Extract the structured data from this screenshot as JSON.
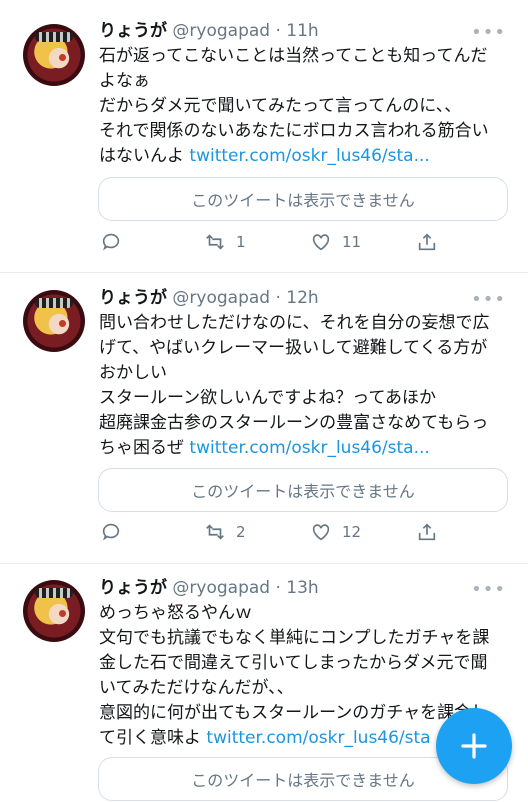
{
  "tweets": [
    {
      "name": "りょうが",
      "handle": "@ryogapad",
      "time": "· 11h",
      "lines": [
        "石が返ってこないことは当然ってことも知ってんだ",
        "よなぁ",
        "だからダメ元で聞いてみたって言ってんのに、、",
        "それで関係のないあなたにボロカス言われる筋合い"
      ],
      "last_text": "はないんよ ",
      "link": "twitter.com/oskr_lus46/sta...",
      "card": "このツイートは表示できません",
      "reply_count": "",
      "retweet_count": "1",
      "like_count": "11"
    },
    {
      "name": "りょうが",
      "handle": "@ryogapad",
      "time": "· 12h",
      "lines": [
        "問い合わせしただけなのに、それを自分の妄想で広",
        "げて、やばいクレーマー扱いして避難してくる方が",
        "おかしい",
        "スタールーン欲しいんですよね？ってあほか",
        "超廃課金古参のスタールーンの豊富さなめてもらっ"
      ],
      "last_text": "ちゃ困るぜ ",
      "link": "twitter.com/oskr_lus46/sta...",
      "card": "このツイートは表示できません",
      "reply_count": "",
      "retweet_count": "2",
      "like_count": "12"
    },
    {
      "name": "りょうが",
      "handle": "@ryogapad",
      "time": "· 13h",
      "lines": [
        "めっちゃ怒るやんｗ",
        "文句でも抗議でもなく単純にコンプしたガチャを課",
        "金した石で間違えて引いてしまったからダメ元で聞",
        "いてみただけなんだが、、",
        "意図的に何が出てもスタールーンのガチャを課金し"
      ],
      "last_text": "て引く意味よ ",
      "link": "twitter.com/oskr_lus46/sta",
      "card": "このツイートは表示できません"
    }
  ],
  "colors": {
    "accent": "#1da1f2",
    "link": "#1b95e0",
    "secondary": "#657786"
  },
  "icons": {
    "more": "more-dots-icon",
    "reply": "reply-icon",
    "retweet": "retweet-icon",
    "like": "heart-icon",
    "share": "share-icon",
    "compose": "compose-plus-icon"
  }
}
